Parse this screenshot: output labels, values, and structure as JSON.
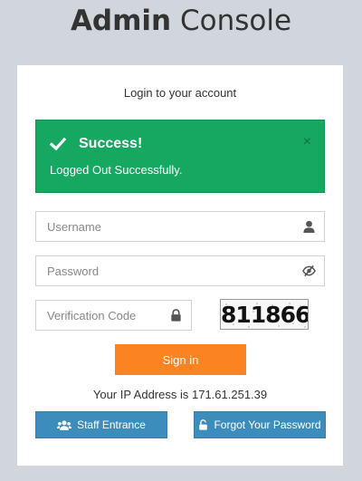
{
  "header": {
    "title_bold": "Admin",
    "title_light": "Console"
  },
  "login": {
    "subtitle": "Login to your account",
    "alert": {
      "title": "Success!",
      "message": "Logged Out Successfully.",
      "close": "×",
      "color": "#16a861"
    },
    "username_placeholder": "Username",
    "password_placeholder": "Password",
    "verification_placeholder": "Verification Code",
    "captcha_text": "811866",
    "signin_label": "Sign in",
    "ip_text": "Your IP Address is 171.61.251.39",
    "staff_label": "Staff Entrance",
    "forgot_label": "Forgot Your Password"
  },
  "icons": [
    "check-icon",
    "user-icon",
    "eye-slash-icon",
    "lock-icon",
    "users-icon",
    "unlock-icon"
  ],
  "colors": {
    "primary": "#3c8dbc",
    "accent": "#fb8321",
    "success": "#16a861",
    "background": "#d1d5dc"
  }
}
